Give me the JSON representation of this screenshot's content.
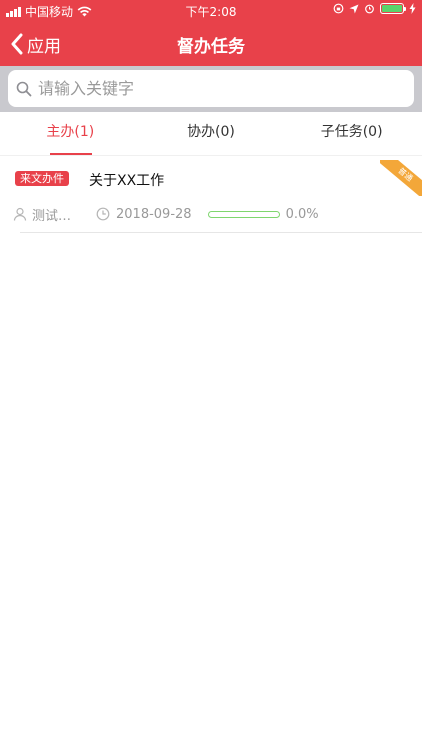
{
  "status_bar": {
    "carrier": "中国移动",
    "time": "下午2:08"
  },
  "nav": {
    "back_label": "应用",
    "title": "督办任务"
  },
  "search": {
    "placeholder": "请输入关键字",
    "value": ""
  },
  "tabs": [
    {
      "label": "主办(1)",
      "active": true
    },
    {
      "label": "协办(0)",
      "active": false
    },
    {
      "label": "子任务(0)",
      "active": false
    }
  ],
  "tasks": [
    {
      "badge": "来文办件",
      "title": "关于XX工作",
      "corner_label": "普通",
      "user": "测试…",
      "date": "2018-09-28",
      "progress": 0.0,
      "progress_text": "0.0%"
    }
  ],
  "colors": {
    "brand": "#e8414a",
    "corner": "#f3a739",
    "progress": "#7fd66e",
    "battery": "#5bd36b"
  }
}
